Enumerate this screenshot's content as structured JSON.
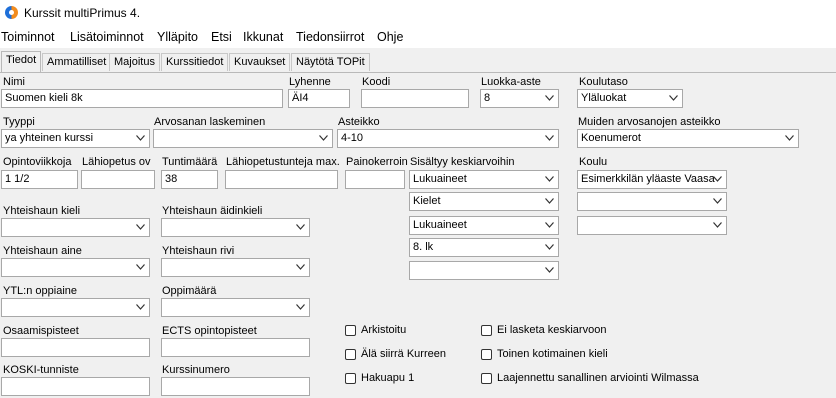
{
  "window": {
    "title": "Kurssit multiPrimus 4."
  },
  "menu": [
    "Toiminnot",
    "Lisätoiminnot",
    "Ylläpito",
    "Etsi",
    "Ikkunat",
    "Tiedonsiirrot",
    "Ohje"
  ],
  "tabs": [
    "Tiedot",
    "Ammatilliset",
    "Majoitus",
    "Kurssitiedot",
    "Kuvaukset",
    "Näytötä TOPit"
  ],
  "active_tab": "Tiedot",
  "form": {
    "nimi": {
      "label": "Nimi",
      "value": "Suomen kieli 8k"
    },
    "lyhenne": {
      "label": "Lyhenne",
      "value": "ÄI4"
    },
    "koodi": {
      "label": "Koodi",
      "value": ""
    },
    "luokka_aste": {
      "label": "Luokka-aste",
      "value": "8"
    },
    "koulutaso": {
      "label": "Koulutaso",
      "value": "Yläluokat"
    },
    "tyyppi": {
      "label": "Tyyppi",
      "value": "ya yhteinen kurssi"
    },
    "arvosanan_laskeminen": {
      "label": "Arvosanan laskeminen",
      "value": ""
    },
    "asteikko": {
      "label": "Asteikko",
      "value": "4-10"
    },
    "muiden_asteikko": {
      "label": "Muiden arvosanojen asteikko",
      "value": "Koenumerot"
    },
    "opintoviikkoja": {
      "label": "Opintoviikkoja",
      "value": "1 1/2"
    },
    "lahiopetus_ov": {
      "label": "Lähiopetus ov",
      "value": ""
    },
    "tuntimaara": {
      "label": "Tuntimäärä",
      "value": "38"
    },
    "lahiopetustunteja": {
      "label": "Lähiopetustunteja max.",
      "value": ""
    },
    "painokerroin": {
      "label": "Painokerroin",
      "value": ""
    },
    "sisaltyy": {
      "label": "Sisältyy keskiarvoihin",
      "values": [
        "Lukuaineet",
        "Kielet",
        "Lukuaineet",
        "8. lk",
        ""
      ]
    },
    "koulu": {
      "label": "Koulu",
      "values": [
        "Esimerkkilän yläaste Vaasa",
        "",
        ""
      ]
    },
    "yhteishaun_kieli": {
      "label": "Yhteishaun kieli",
      "value": ""
    },
    "yhteishaun_aidinkieli": {
      "label": "Yhteishaun äidinkieli",
      "value": ""
    },
    "yhteishaun_aine": {
      "label": "Yhteishaun aine",
      "value": ""
    },
    "yhteishaun_rivi": {
      "label": "Yhteishaun rivi",
      "value": ""
    },
    "ytl_oppiaine": {
      "label": "YTL:n oppiaine",
      "value": ""
    },
    "oppimaara": {
      "label": "Oppimäärä",
      "value": ""
    },
    "osaamispisteet": {
      "label": "Osaamispisteet",
      "value": ""
    },
    "ects": {
      "label": "ECTS opintopisteet",
      "value": ""
    },
    "koski": {
      "label": "KOSKI-tunniste",
      "value": ""
    },
    "kurssinumero": {
      "label": "Kurssinumero",
      "value": ""
    }
  },
  "checkboxes": {
    "arkistoitu": "Arkistoitu",
    "ala_siirra": "Älä siirrä Kurreen",
    "hakuapu": "Hakuapu 1",
    "ei_lasketa": "Ei lasketa keskiarvoon",
    "toinen_kieli": "Toinen kotimainen kieli",
    "laajennettu": "Laajennettu sanallinen arviointi Wilmassa"
  }
}
